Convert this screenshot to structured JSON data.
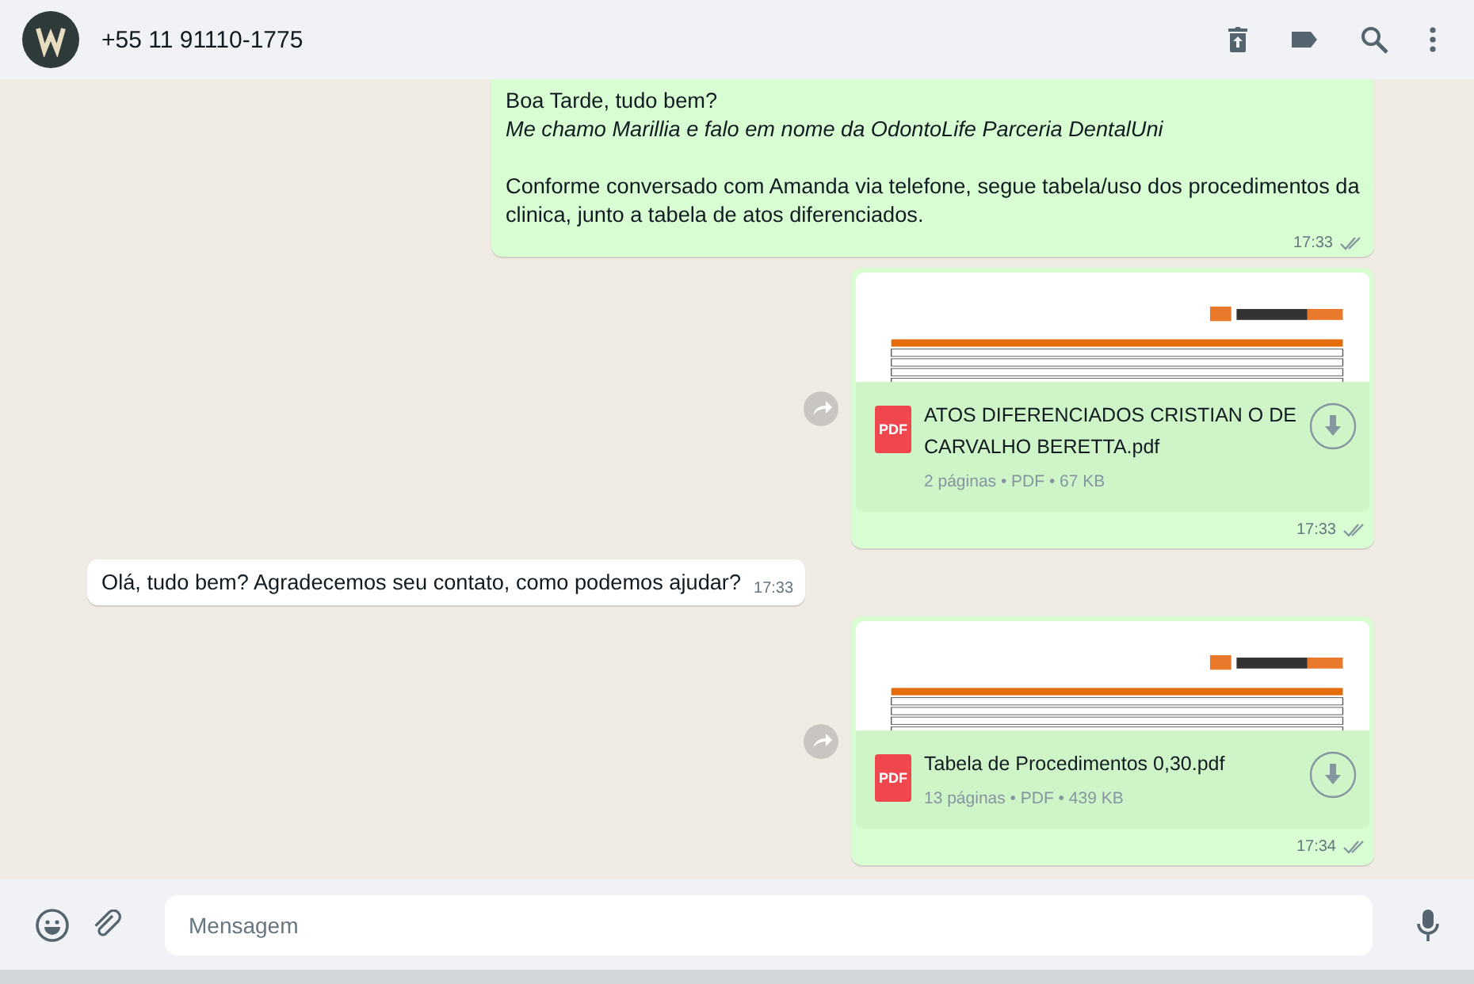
{
  "header": {
    "contact": "+55 11 91110-1775"
  },
  "messages": [
    {
      "kind": "text",
      "outgoing": true,
      "paragraphs": [
        "Boa Tarde, tudo bem?\n*Me chamo Marillia e falo em nome da OdontoLife Parceria DentalUni*",
        "Conforme conversado com Amanda via telefone, segue tabela/uso dos procedimentos da clinica, junto a tabela de atos diferenciados."
      ],
      "time": "17:33",
      "read": false
    },
    {
      "kind": "document",
      "outgoing": true,
      "filename": "ATOS DIFERENCIADOS CRISTIAN O DE CARVALHO BERETTA.pdf",
      "meta": "2 páginas • PDF • 67 KB",
      "file_badge": "PDF",
      "time": "17:33",
      "read": false
    },
    {
      "kind": "text",
      "outgoing": false,
      "paragraphs": [
        "Olá, tudo bem? Agradecemos seu contato, como podemos ajudar?"
      ],
      "time": "17:33"
    },
    {
      "kind": "document",
      "outgoing": true,
      "filename": "Tabela de Procedimentos 0,30.pdf",
      "meta": "13 páginas • PDF • 439 KB",
      "file_badge": "PDF",
      "time": "17:34",
      "read": false
    }
  ],
  "composer": {
    "placeholder": "Mensagem"
  }
}
